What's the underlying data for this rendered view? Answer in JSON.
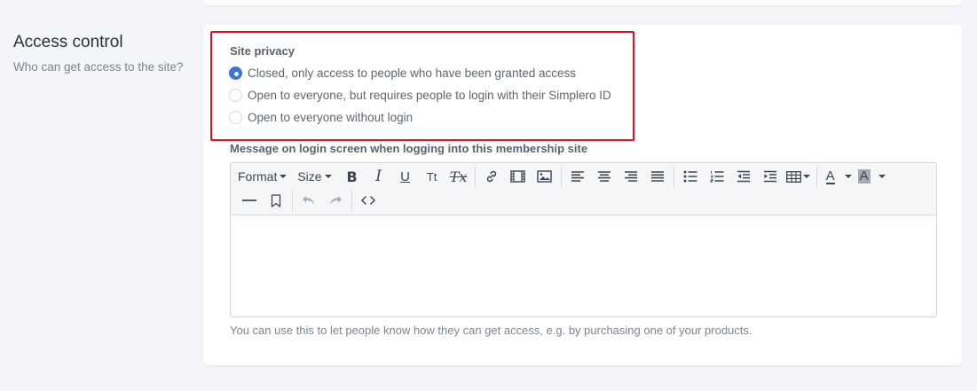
{
  "section": {
    "title": "Access control",
    "description": "Who can get access to the site?"
  },
  "site_privacy": {
    "label": "Site privacy",
    "options": [
      {
        "label": "Closed, only access to people who have been granted access",
        "checked": true
      },
      {
        "label": "Open to everyone, but requires people to login with their Simplero ID",
        "checked": false
      },
      {
        "label": "Open to everyone without login",
        "checked": false
      }
    ]
  },
  "login_message": {
    "label": "Message on login screen when logging into this membership site",
    "value": "",
    "help": "You can use this to let people know how they can get access, e.g. by purchasing one of your products."
  },
  "toolbar": {
    "format_label": "Format",
    "size_label": "Size",
    "bold": "B",
    "italic": "I",
    "underline": "U",
    "text_case": "Tt",
    "clear_format": "Tx",
    "font_color": "A",
    "highlight_color": "A",
    "icons": [
      "bold-icon",
      "italic-icon",
      "underline-icon",
      "text-case-icon",
      "clear-format-icon",
      "link-icon",
      "video-icon",
      "image-icon",
      "align-left-icon",
      "align-center-icon",
      "align-right-icon",
      "align-justify-icon",
      "bullet-list-icon",
      "numbered-list-icon",
      "outdent-icon",
      "indent-icon",
      "table-icon",
      "font-color-icon",
      "highlight-color-icon",
      "horizontal-rule-icon",
      "bookmark-icon",
      "undo-icon",
      "redo-icon",
      "source-code-icon"
    ]
  },
  "colors": {
    "accent": "#3a73d9",
    "highlight_border": "#e0121d",
    "page_background": "#f3f5f8"
  }
}
